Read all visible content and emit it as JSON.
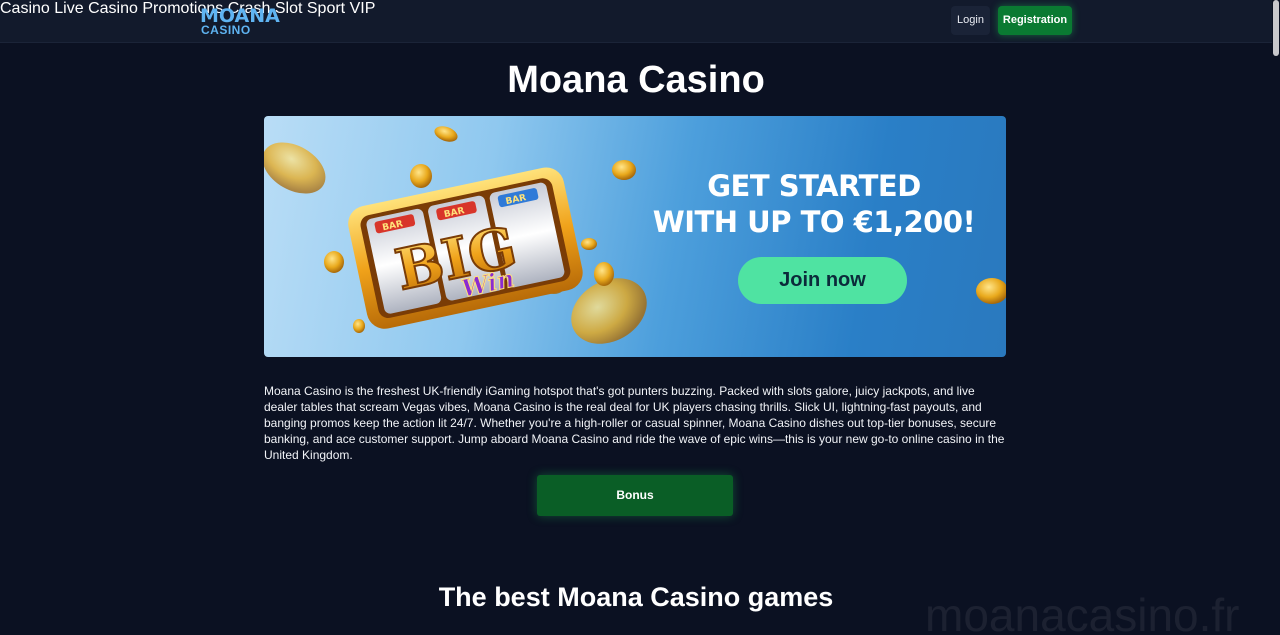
{
  "header": {
    "logo": {
      "top": "MOANA",
      "bottom": "CASINO"
    },
    "nav": [
      {
        "label": "Casino"
      },
      {
        "label": "Live Casino"
      },
      {
        "label": "Promotions"
      },
      {
        "label": "Crash"
      },
      {
        "label": "Slot"
      },
      {
        "label": "Sport"
      },
      {
        "label": "VIP"
      }
    ],
    "login_label": "Login",
    "register_label": "Registration"
  },
  "main": {
    "title": "Moana Casino",
    "banner": {
      "headline_line1": "GET STARTED",
      "headline_line2": "WITH UP TO €1,200!",
      "join_label": "Join now",
      "slot_big": "BIG",
      "slot_win": "Win",
      "slot_bar": "BAR"
    },
    "intro": "Moana Casino is the freshest UK-friendly iGaming hotspot that's got punters buzzing. Packed with slots galore, juicy jackpots, and live dealer tables that scream Vegas vibes, Moana Casino is the real deal for UK players chasing thrills. Slick UI, lightning-fast payouts, and banging promos keep the action lit 24/7. Whether you're a high-roller or casual spinner, Moana Casino dishes out top-tier bonuses, secure banking, and ace customer support. Jump aboard Moana Casino and ride the wave of epic wins—this is your new go-to online casino in the United Kingdom.",
    "bonus_label": "Bonus",
    "section_title": "The best Moana Casino games"
  },
  "watermark": "moanacasino.fr",
  "colors": {
    "background": "#0b1122",
    "header": "#121a2c",
    "accent_green": "#0a7a32",
    "join_button": "#4fe3a2",
    "logo_blue": "#5fb4f2"
  }
}
